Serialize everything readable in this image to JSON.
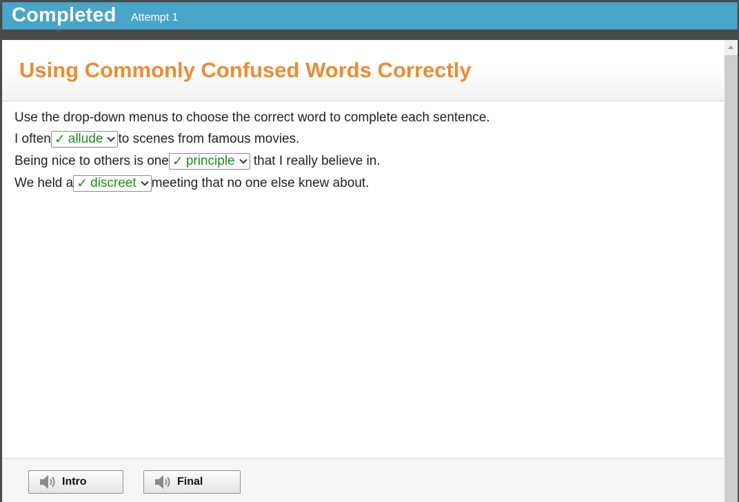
{
  "header": {
    "status": "Completed",
    "attempt": "Attempt 1"
  },
  "page": {
    "title": "Using Commonly Confused Words Correctly",
    "instruction": "Use the drop-down menus to choose the correct word to complete each sentence."
  },
  "sentences": [
    {
      "before": "I often",
      "selected": "allude",
      "after": "to scenes from famous movies."
    },
    {
      "before": "Being nice to others is one",
      "selected": "principle",
      "after": " that I really believe in."
    },
    {
      "before": "We held a",
      "selected": "discreet",
      "after": "meeting that no one else knew about."
    }
  ],
  "footer": {
    "intro_label": "Intro",
    "final_label": "Final"
  },
  "icons": {
    "correct": "checkmark-icon",
    "dropdown": "chevron-down-icon",
    "audio": "speaker-icon"
  },
  "colors": {
    "header_bg": "#49a5c9",
    "title": "#ec8c32",
    "correct": "#1e8a24"
  }
}
